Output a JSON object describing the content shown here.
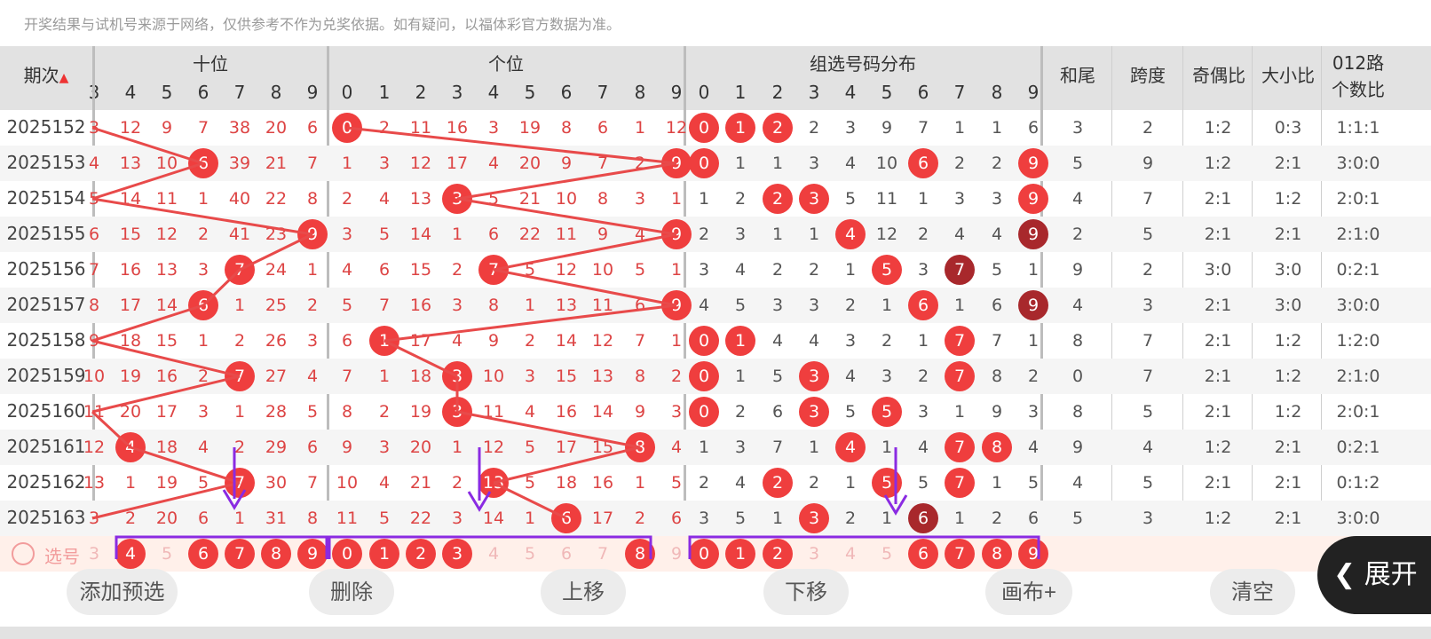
{
  "notice": "开奖结果与试机号来源于网络，仅供参考不作为兑奖依据。如有疑问，以福体彩官方数据为准。",
  "header": {
    "period_label": "期次",
    "sort_icon": "sort-up-down-icon",
    "group_tens": "十位",
    "group_units": "个位",
    "group_combo": "组选号码分布",
    "sum_tail": "和尾",
    "span": "跨度",
    "odd_even": "奇偶比",
    "big_small": "大小比",
    "ratio012_l1": "012路",
    "ratio012_l2": "个数比",
    "tens_cols": [
      "3",
      "4",
      "5",
      "6",
      "7",
      "8",
      "9"
    ],
    "digits": [
      "0",
      "1",
      "2",
      "3",
      "4",
      "5",
      "6",
      "7",
      "8",
      "9"
    ]
  },
  "rows": [
    {
      "period": "2025152",
      "tens": [
        "3",
        "12",
        "9",
        "7",
        "38",
        "20",
        "6"
      ],
      "units": [
        "0",
        "2",
        "11",
        "16",
        "3",
        "19",
        "8",
        "6",
        "1",
        "12"
      ],
      "combo": [
        "0",
        "1",
        "2",
        "2",
        "3",
        "9",
        "7",
        "1",
        "1",
        "6"
      ],
      "sum_tail": "3",
      "span": "2",
      "odd_even": "1:2",
      "big_small": "0:3",
      "ratio012": "1:1:1"
    },
    {
      "period": "2025153",
      "tens": [
        "4",
        "13",
        "10",
        "6",
        "39",
        "21",
        "7"
      ],
      "units": [
        "1",
        "3",
        "12",
        "17",
        "4",
        "20",
        "9",
        "7",
        "2",
        "9"
      ],
      "combo": [
        "0",
        "1",
        "1",
        "3",
        "4",
        "10",
        "6",
        "2",
        "2",
        "9"
      ],
      "sum_tail": "5",
      "span": "9",
      "odd_even": "1:2",
      "big_small": "2:1",
      "ratio012": "3:0:0"
    },
    {
      "period": "2025154",
      "tens": [
        "5",
        "14",
        "11",
        "1",
        "40",
        "22",
        "8"
      ],
      "units": [
        "2",
        "4",
        "13",
        "3",
        "5",
        "21",
        "10",
        "8",
        "3",
        "1"
      ],
      "combo": [
        "1",
        "2",
        "2",
        "3",
        "5",
        "11",
        "1",
        "3",
        "3",
        "9"
      ],
      "sum_tail": "4",
      "span": "7",
      "odd_even": "2:1",
      "big_small": "1:2",
      "ratio012": "2:0:1"
    },
    {
      "period": "2025155",
      "tens": [
        "6",
        "15",
        "12",
        "2",
        "41",
        "23",
        "9"
      ],
      "units": [
        "3",
        "5",
        "14",
        "1",
        "6",
        "22",
        "11",
        "9",
        "4",
        "9"
      ],
      "combo": [
        "2",
        "3",
        "1",
        "1",
        "4",
        "12",
        "2",
        "4",
        "4",
        "9"
      ],
      "sum_tail": "2",
      "span": "5",
      "odd_even": "2:1",
      "big_small": "2:1",
      "ratio012": "2:1:0"
    },
    {
      "period": "2025156",
      "tens": [
        "7",
        "16",
        "13",
        "3",
        "7",
        "24",
        "1"
      ],
      "units": [
        "4",
        "6",
        "15",
        "2",
        "7",
        "5",
        "12",
        "10",
        "5",
        "1"
      ],
      "combo": [
        "3",
        "4",
        "2",
        "2",
        "1",
        "5",
        "3",
        "7",
        "5",
        "1"
      ],
      "sum_tail": "9",
      "span": "2",
      "odd_even": "3:0",
      "big_small": "3:0",
      "ratio012": "0:2:1"
    },
    {
      "period": "2025157",
      "tens": [
        "8",
        "17",
        "14",
        "6",
        "1",
        "25",
        "2"
      ],
      "units": [
        "5",
        "7",
        "16",
        "3",
        "8",
        "1",
        "13",
        "11",
        "6",
        "9"
      ],
      "combo": [
        "4",
        "5",
        "3",
        "3",
        "2",
        "1",
        "6",
        "1",
        "6",
        "9"
      ],
      "sum_tail": "4",
      "span": "3",
      "odd_even": "2:1",
      "big_small": "3:0",
      "ratio012": "3:0:0"
    },
    {
      "period": "2025158",
      "tens": [
        "9",
        "18",
        "15",
        "1",
        "2",
        "26",
        "3"
      ],
      "units": [
        "6",
        "1",
        "17",
        "4",
        "9",
        "2",
        "14",
        "12",
        "7",
        "1"
      ],
      "combo": [
        "0",
        "1",
        "4",
        "4",
        "3",
        "2",
        "1",
        "7",
        "7",
        "1"
      ],
      "sum_tail": "8",
      "span": "7",
      "odd_even": "2:1",
      "big_small": "1:2",
      "ratio012": "1:2:0"
    },
    {
      "period": "2025159",
      "tens": [
        "10",
        "19",
        "16",
        "2",
        "7",
        "27",
        "4"
      ],
      "units": [
        "7",
        "1",
        "18",
        "3",
        "10",
        "3",
        "15",
        "13",
        "8",
        "2"
      ],
      "combo": [
        "0",
        "1",
        "5",
        "3",
        "4",
        "3",
        "2",
        "7",
        "8",
        "2"
      ],
      "sum_tail": "0",
      "span": "7",
      "odd_even": "2:1",
      "big_small": "1:2",
      "ratio012": "2:1:0"
    },
    {
      "period": "2025160",
      "tens": [
        "11",
        "20",
        "17",
        "3",
        "1",
        "28",
        "5"
      ],
      "units": [
        "8",
        "2",
        "19",
        "3",
        "11",
        "4",
        "16",
        "14",
        "9",
        "3"
      ],
      "combo": [
        "0",
        "2",
        "6",
        "3",
        "5",
        "5",
        "3",
        "1",
        "9",
        "3"
      ],
      "sum_tail": "8",
      "span": "5",
      "odd_even": "2:1",
      "big_small": "1:2",
      "ratio012": "2:0:1"
    },
    {
      "period": "2025161",
      "tens": [
        "12",
        "4",
        "18",
        "4",
        "2",
        "29",
        "6"
      ],
      "units": [
        "9",
        "3",
        "20",
        "1",
        "12",
        "5",
        "17",
        "15",
        "8",
        "4"
      ],
      "combo": [
        "1",
        "3",
        "7",
        "1",
        "4",
        "1",
        "4",
        "7",
        "8",
        "4"
      ],
      "sum_tail": "9",
      "span": "4",
      "odd_even": "1:2",
      "big_small": "2:1",
      "ratio012": "0:2:1"
    },
    {
      "period": "2025162",
      "tens": [
        "13",
        "1",
        "19",
        "5",
        "7",
        "30",
        "7"
      ],
      "units": [
        "10",
        "4",
        "21",
        "2",
        "13",
        "5",
        "18",
        "16",
        "1",
        "5"
      ],
      "combo": [
        "2",
        "4",
        "2",
        "2",
        "1",
        "5",
        "5",
        "7",
        "1",
        "5"
      ],
      "sum_tail": "4",
      "span": "5",
      "odd_even": "2:1",
      "big_small": "2:1",
      "ratio012": "0:1:2"
    },
    {
      "period": "2025163",
      "tens": [
        "3",
        "2",
        "20",
        "6",
        "1",
        "31",
        "8"
      ],
      "units": [
        "11",
        "5",
        "22",
        "3",
        "14",
        "1",
        "6",
        "17",
        "2",
        "6"
      ],
      "combo": [
        "3",
        "5",
        "1",
        "3",
        "2",
        "1",
        "6",
        "1",
        "2",
        "6"
      ],
      "sum_tail": "5",
      "span": "3",
      "odd_even": "1:2",
      "big_small": "2:1",
      "ratio012": "3:0:0"
    }
  ],
  "select_row": {
    "label": "选号",
    "tens": [
      "3",
      "4",
      "5",
      "6",
      "7",
      "8",
      "9"
    ],
    "units": [
      "0",
      "1",
      "2",
      "3",
      "4",
      "5",
      "6",
      "7",
      "8",
      "9"
    ],
    "combo": [
      "0",
      "1",
      "2",
      "3",
      "4",
      "5",
      "6",
      "7",
      "8",
      "9"
    ]
  },
  "buttons": {
    "add": "添加预选",
    "delete": "删除",
    "up": "上移",
    "down": "下移",
    "canvas": "画布+",
    "clear": "清空"
  },
  "expand": {
    "icon": "chevron-left-icon",
    "label": "展开"
  },
  "colors": {
    "ball": "#ef3e3e",
    "ball_dark": "#a8282c",
    "line": "#e84a4a",
    "select_box": "#8a2be2",
    "header_bg": "#e2e2e2"
  }
}
